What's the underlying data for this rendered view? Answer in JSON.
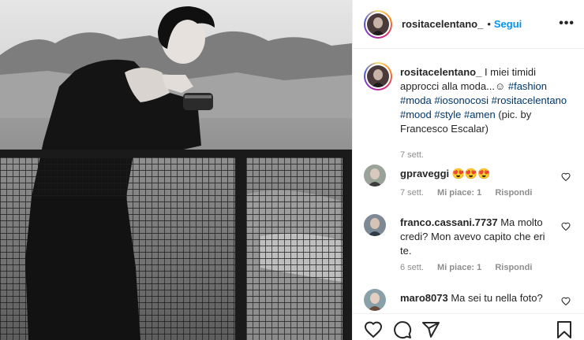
{
  "post": {
    "username": "rositacelentano_",
    "separator": "•",
    "follow_label": "Segui",
    "more_label": "•••"
  },
  "caption": {
    "username": "rositacelentano_",
    "text_plain": "I miei timidi approcci alla moda...☺",
    "hashtags": [
      "#fashion",
      "#moda",
      "#iosonocosi",
      "#rositacelentano",
      "#mood",
      "#style",
      "#amen"
    ],
    "credit": "(pic. by Francesco Escalar)",
    "time": "7 sett."
  },
  "comments": [
    {
      "username": "gpraveggi",
      "text": "😍😍😍",
      "time": "7 sett.",
      "likes": "Mi piace: 1",
      "reply": "Rispondi"
    },
    {
      "username": "franco.cassani.7737",
      "text": "Ma molto credi? Mon avevo capito che eri te.",
      "time": "6 sett.",
      "likes": "Mi piace: 1",
      "reply": "Rispondi"
    },
    {
      "username": "maro8073",
      "text": "Ma sei tu nella foto?"
    }
  ],
  "icons": {
    "like": "heart-icon",
    "comment": "comment-bubble-icon",
    "share": "paper-plane-icon",
    "save": "bookmark-icon",
    "comment_like": "small-heart-icon"
  },
  "colors": {
    "link_blue": "#0095f6",
    "hashtag": "#00376b",
    "muted": "#8e8e8e",
    "text": "#262626"
  }
}
